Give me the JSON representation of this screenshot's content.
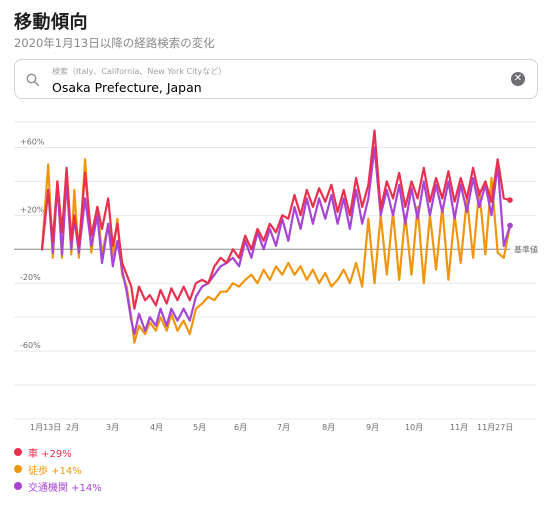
{
  "header": {
    "title": "移動傾向",
    "subtitle": "2020年1月13日以降の経路検索の変化"
  },
  "search": {
    "placeholder": "検索（Italy、California、New York Cityなど）",
    "value": "Osaka Prefecture, Japan"
  },
  "legend": [
    {
      "label": "車 +29%",
      "color": "#e8304f"
    },
    {
      "label": "徒歩 +14%",
      "color": "#f0960e"
    },
    {
      "label": "交通機関 +14%",
      "color": "#a745d6"
    }
  ],
  "chart_data": {
    "type": "line",
    "baseline_label": "基準値",
    "y_ticks": [
      "+60%",
      "+20%",
      "-20%",
      "-60%"
    ],
    "ylim": [
      -100,
      75
    ],
    "x_labels": [
      "1月13日",
      "2月",
      "3月",
      "4月",
      "5月",
      "6月",
      "7月",
      "8月",
      "9月",
      "10月",
      "11月",
      "11月27日"
    ],
    "grid": true,
    "series": [
      {
        "name": "車",
        "color": "#e8304f",
        "values": [
          [
            0,
            0
          ],
          [
            4,
            35
          ],
          [
            7,
            5
          ],
          [
            10,
            40
          ],
          [
            13,
            10
          ],
          [
            16,
            48
          ],
          [
            19,
            5
          ],
          [
            21,
            20
          ],
          [
            24,
            2
          ],
          [
            28,
            45
          ],
          [
            32,
            8
          ],
          [
            36,
            25
          ],
          [
            39,
            12
          ],
          [
            43,
            30
          ],
          [
            46,
            2
          ],
          [
            49,
            15
          ],
          [
            52,
            -8
          ],
          [
            55,
            -15
          ],
          [
            58,
            -22
          ],
          [
            60,
            -35
          ],
          [
            63,
            -22
          ],
          [
            67,
            -30
          ],
          [
            70,
            -27
          ],
          [
            74,
            -33
          ],
          [
            77,
            -24
          ],
          [
            81,
            -32
          ],
          [
            84,
            -23
          ],
          [
            88,
            -30
          ],
          [
            92,
            -22
          ],
          [
            96,
            -30
          ],
          [
            100,
            -20
          ],
          [
            104,
            -18
          ],
          [
            108,
            -20
          ],
          [
            112,
            -10
          ],
          [
            116,
            -5
          ],
          [
            120,
            -8
          ],
          [
            124,
            0
          ],
          [
            128,
            -5
          ],
          [
            132,
            8
          ],
          [
            136,
            0
          ],
          [
            140,
            12
          ],
          [
            144,
            5
          ],
          [
            148,
            15
          ],
          [
            152,
            10
          ],
          [
            156,
            20
          ],
          [
            160,
            18
          ],
          [
            164,
            32
          ],
          [
            168,
            20
          ],
          [
            172,
            35
          ],
          [
            176,
            25
          ],
          [
            180,
            36
          ],
          [
            184,
            28
          ],
          [
            188,
            38
          ],
          [
            192,
            22
          ],
          [
            196,
            35
          ],
          [
            200,
            20
          ],
          [
            204,
            42
          ],
          [
            208,
            25
          ],
          [
            212,
            38
          ],
          [
            216,
            70
          ],
          [
            220,
            24
          ],
          [
            224,
            40
          ],
          [
            228,
            30
          ],
          [
            232,
            45
          ],
          [
            236,
            25
          ],
          [
            240,
            40
          ],
          [
            244,
            30
          ],
          [
            248,
            48
          ],
          [
            252,
            28
          ],
          [
            256,
            42
          ],
          [
            260,
            30
          ],
          [
            264,
            46
          ],
          [
            268,
            28
          ],
          [
            272,
            42
          ],
          [
            276,
            30
          ],
          [
            280,
            48
          ],
          [
            284,
            32
          ],
          [
            288,
            40
          ],
          [
            292,
            28
          ],
          [
            296,
            53
          ],
          [
            300,
            30
          ],
          [
            304,
            29
          ]
        ]
      },
      {
        "name": "徒歩",
        "color": "#f0960e",
        "values": [
          [
            0,
            0
          ],
          [
            4,
            50
          ],
          [
            7,
            -5
          ],
          [
            10,
            40
          ],
          [
            13,
            -5
          ],
          [
            16,
            46
          ],
          [
            19,
            -3
          ],
          [
            21,
            35
          ],
          [
            24,
            -5
          ],
          [
            28,
            53
          ],
          [
            32,
            -2
          ],
          [
            36,
            25
          ],
          [
            39,
            -3
          ],
          [
            43,
            15
          ],
          [
            46,
            -4
          ],
          [
            49,
            18
          ],
          [
            52,
            -15
          ],
          [
            55,
            -22
          ],
          [
            58,
            -40
          ],
          [
            60,
            -55
          ],
          [
            63,
            -45
          ],
          [
            67,
            -50
          ],
          [
            70,
            -43
          ],
          [
            74,
            -48
          ],
          [
            77,
            -40
          ],
          [
            81,
            -48
          ],
          [
            84,
            -38
          ],
          [
            88,
            -48
          ],
          [
            92,
            -42
          ],
          [
            96,
            -50
          ],
          [
            100,
            -35
          ],
          [
            104,
            -32
          ],
          [
            108,
            -28
          ],
          [
            112,
            -30
          ],
          [
            116,
            -25
          ],
          [
            120,
            -25
          ],
          [
            124,
            -20
          ],
          [
            128,
            -22
          ],
          [
            132,
            -18
          ],
          [
            136,
            -15
          ],
          [
            140,
            -20
          ],
          [
            144,
            -12
          ],
          [
            148,
            -18
          ],
          [
            152,
            -10
          ],
          [
            156,
            -15
          ],
          [
            160,
            -8
          ],
          [
            164,
            -15
          ],
          [
            168,
            -10
          ],
          [
            172,
            -18
          ],
          [
            176,
            -12
          ],
          [
            180,
            -20
          ],
          [
            184,
            -14
          ],
          [
            188,
            -22
          ],
          [
            192,
            -18
          ],
          [
            196,
            -12
          ],
          [
            200,
            -20
          ],
          [
            204,
            -8
          ],
          [
            208,
            -22
          ],
          [
            212,
            18
          ],
          [
            216,
            -20
          ],
          [
            220,
            20
          ],
          [
            224,
            -15
          ],
          [
            228,
            22
          ],
          [
            232,
            -18
          ],
          [
            236,
            20
          ],
          [
            240,
            -15
          ],
          [
            244,
            25
          ],
          [
            248,
            -20
          ],
          [
            252,
            20
          ],
          [
            256,
            -12
          ],
          [
            260,
            25
          ],
          [
            264,
            -18
          ],
          [
            268,
            20
          ],
          [
            272,
            -8
          ],
          [
            276,
            30
          ],
          [
            280,
            -5
          ],
          [
            284,
            35
          ],
          [
            288,
            -3
          ],
          [
            292,
            42
          ],
          [
            296,
            -2
          ],
          [
            300,
            -5
          ],
          [
            304,
            14
          ]
        ]
      },
      {
        "name": "交通機関",
        "color": "#a745d6",
        "values": [
          [
            0,
            0
          ],
          [
            4,
            35
          ],
          [
            7,
            -2
          ],
          [
            10,
            38
          ],
          [
            13,
            -3
          ],
          [
            16,
            40
          ],
          [
            19,
            0
          ],
          [
            21,
            18
          ],
          [
            24,
            -2
          ],
          [
            28,
            30
          ],
          [
            32,
            2
          ],
          [
            36,
            20
          ],
          [
            39,
            -8
          ],
          [
            43,
            15
          ],
          [
            46,
            -10
          ],
          [
            49,
            5
          ],
          [
            52,
            -12
          ],
          [
            55,
            -25
          ],
          [
            58,
            -42
          ],
          [
            60,
            -50
          ],
          [
            63,
            -38
          ],
          [
            67,
            -48
          ],
          [
            70,
            -40
          ],
          [
            74,
            -45
          ],
          [
            77,
            -35
          ],
          [
            81,
            -45
          ],
          [
            84,
            -35
          ],
          [
            88,
            -42
          ],
          [
            92,
            -35
          ],
          [
            96,
            -42
          ],
          [
            100,
            -28
          ],
          [
            104,
            -22
          ],
          [
            108,
            -20
          ],
          [
            112,
            -15
          ],
          [
            116,
            -10
          ],
          [
            120,
            -8
          ],
          [
            124,
            -5
          ],
          [
            128,
            -10
          ],
          [
            132,
            5
          ],
          [
            136,
            -5
          ],
          [
            140,
            10
          ],
          [
            144,
            0
          ],
          [
            148,
            12
          ],
          [
            152,
            2
          ],
          [
            156,
            18
          ],
          [
            160,
            5
          ],
          [
            164,
            25
          ],
          [
            168,
            12
          ],
          [
            172,
            30
          ],
          [
            176,
            15
          ],
          [
            180,
            30
          ],
          [
            184,
            18
          ],
          [
            188,
            32
          ],
          [
            192,
            15
          ],
          [
            196,
            30
          ],
          [
            200,
            12
          ],
          [
            204,
            35
          ],
          [
            208,
            15
          ],
          [
            212,
            30
          ],
          [
            216,
            60
          ],
          [
            220,
            20
          ],
          [
            224,
            35
          ],
          [
            228,
            20
          ],
          [
            232,
            38
          ],
          [
            236,
            15
          ],
          [
            240,
            36
          ],
          [
            244,
            18
          ],
          [
            248,
            40
          ],
          [
            252,
            20
          ],
          [
            256,
            38
          ],
          [
            260,
            22
          ],
          [
            264,
            40
          ],
          [
            268,
            18
          ],
          [
            272,
            38
          ],
          [
            276,
            22
          ],
          [
            280,
            42
          ],
          [
            284,
            25
          ],
          [
            288,
            38
          ],
          [
            292,
            20
          ],
          [
            296,
            50
          ],
          [
            300,
            2
          ],
          [
            304,
            14
          ]
        ]
      }
    ]
  }
}
